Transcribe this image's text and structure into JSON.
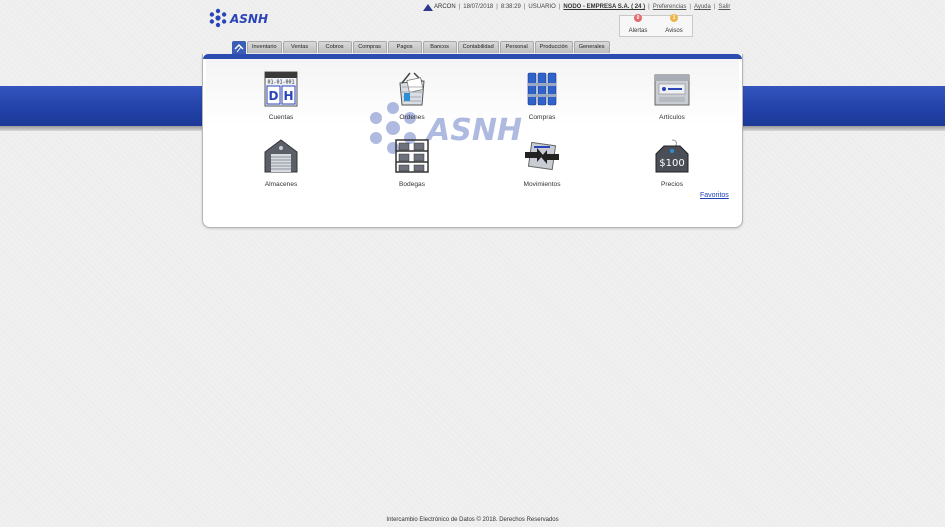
{
  "header": {
    "logo_text": "ASNH",
    "brand_name": "ARCON",
    "date": "18/07/2018",
    "time": "8:38:29",
    "user_label": "USUARIO",
    "company": "NODO - EMPRESA S.A. ( 24 )",
    "links": [
      "Preferencias",
      "Ayuda",
      "Salir"
    ],
    "alerts": {
      "label": "Alertas",
      "count": "0"
    },
    "notices": {
      "label": "Avisos",
      "count": "1"
    }
  },
  "tabs": [
    "Inventario",
    "Ventas",
    "Cobros",
    "Compras",
    "Pagos",
    "Bancos",
    "Contabilidad",
    "Personal",
    "Producción",
    "Generales"
  ],
  "modules": [
    {
      "label": "Cuentas",
      "icon": "ledger-dh-icon"
    },
    {
      "label": "Ordenes",
      "icon": "shopping-basket-icon"
    },
    {
      "label": "Compras",
      "icon": "stacked-containers-icon"
    },
    {
      "label": "Artículos",
      "icon": "product-box-icon"
    },
    {
      "label": "Almacenes",
      "icon": "warehouse-icon"
    },
    {
      "label": "Bodegas",
      "icon": "storage-rack-icon"
    },
    {
      "label": "Movimientos",
      "icon": "transfer-arrows-icon"
    },
    {
      "label": "Precios",
      "icon": "price-tag-icon"
    }
  ],
  "ledger_icon": {
    "date": "01-01-001",
    "left": "D",
    "right": "H"
  },
  "price_icon_text": "$100",
  "favorites_label": "Favoritos",
  "footer_text": "Intercambio Electrónico de Datos © 2018. Derechos Reservados",
  "colors": {
    "band": "#2241a8",
    "accent": "#2b4db0",
    "link": "#1f3fb5"
  }
}
